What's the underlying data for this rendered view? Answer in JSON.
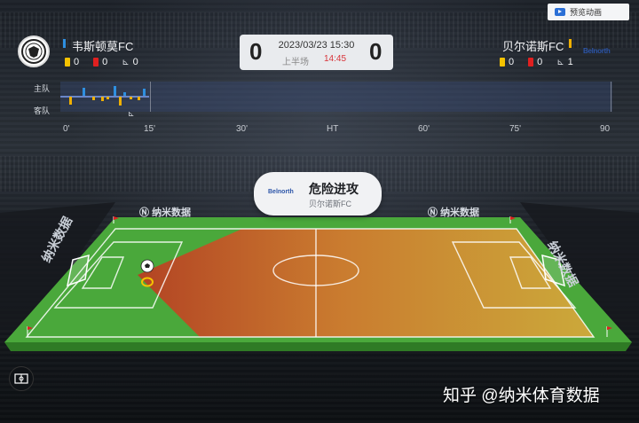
{
  "preview_button": {
    "label": "预览动画",
    "icon": "play-icon"
  },
  "home": {
    "name": "韦斯顿莫FC",
    "color": "#2e8fe0",
    "yellow_cards": "0",
    "red_cards": "0",
    "corners": "0"
  },
  "away": {
    "name": "贝尔诺斯FC",
    "color": "#f0b000",
    "logo_text": "Belnorth",
    "yellow_cards": "0",
    "red_cards": "0",
    "corners": "1"
  },
  "scoreboard": {
    "home_score": "0",
    "away_score": "0",
    "datetime": "2023/03/23 15:30",
    "half": "上半场",
    "match_time": "14:45"
  },
  "timeline": {
    "home_label": "主队",
    "away_label": "客队",
    "ticks": [
      "0'",
      "15'",
      "30'",
      "HT",
      "60'",
      "75'",
      "90"
    ],
    "current_minute": 14.75
  },
  "event": {
    "title": "危险进攻",
    "team": "贝尔诺斯FC",
    "logo_text": "Belnorth"
  },
  "pitch": {
    "brand": "纳米数据",
    "ball": "ball-icon"
  },
  "watermark": "知乎 @纳米体育数据",
  "colors": {
    "pitch_green": "#49a83a",
    "danger_zone_start": "#c24a2a",
    "danger_zone_end": "#e8a030",
    "yellow_card": "#f5c200",
    "red_card": "#e02020"
  }
}
